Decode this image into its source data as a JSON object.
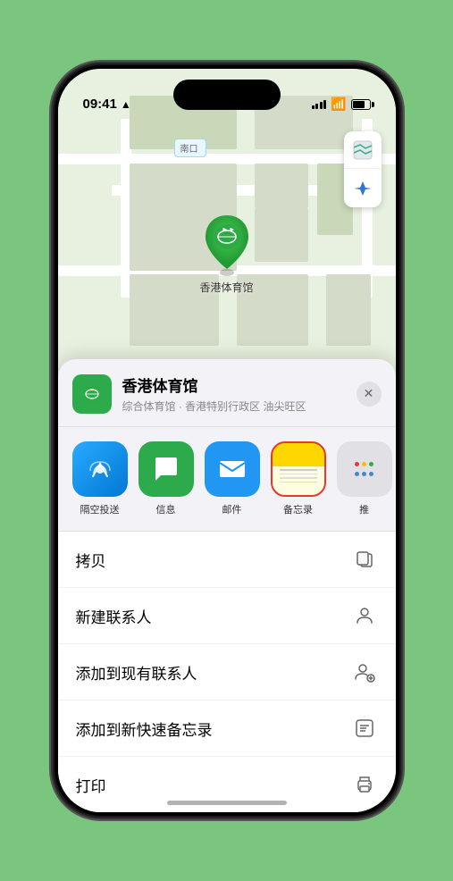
{
  "statusBar": {
    "time": "09:41",
    "locationArrow": "▲"
  },
  "map": {
    "label": "南口",
    "mapTypeIcon": "🗺",
    "locationIcon": "➤"
  },
  "placeCard": {
    "name": "香港体育馆",
    "subtitle": "综合体育馆 · 香港特别行政区 油尖旺区",
    "closeLabel": "✕"
  },
  "shareItems": [
    {
      "id": "airdrop",
      "label": "隔空投送",
      "iconType": "airdrop"
    },
    {
      "id": "message",
      "label": "信息",
      "iconType": "message"
    },
    {
      "id": "mail",
      "label": "邮件",
      "iconType": "mail"
    },
    {
      "id": "notes",
      "label": "备忘录",
      "iconType": "notes"
    },
    {
      "id": "more",
      "label": "推",
      "iconType": "more"
    }
  ],
  "actionRows": [
    {
      "label": "拷贝",
      "iconName": "copy-icon"
    },
    {
      "label": "新建联系人",
      "iconName": "new-contact-icon"
    },
    {
      "label": "添加到现有联系人",
      "iconName": "add-contact-icon"
    },
    {
      "label": "添加到新快速备忘录",
      "iconName": "quick-note-icon"
    },
    {
      "label": "打印",
      "iconName": "print-icon"
    }
  ]
}
